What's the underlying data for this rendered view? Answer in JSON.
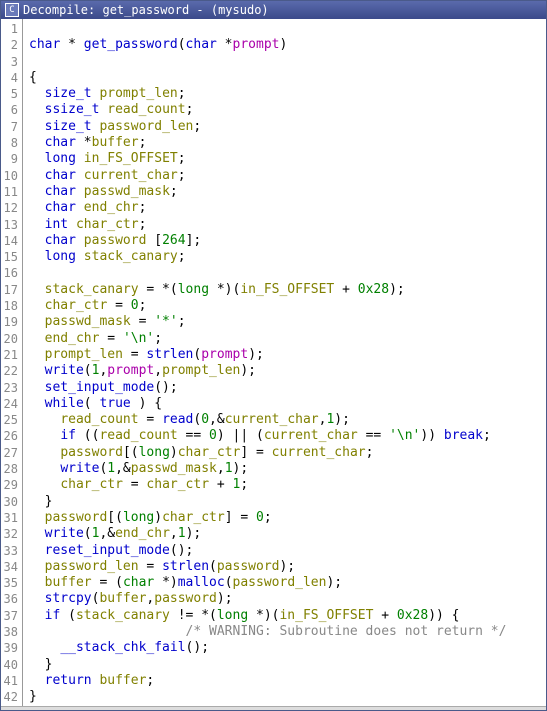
{
  "title": {
    "icon_label": "C",
    "text": "Decompile: get_password -  (mysudo)"
  },
  "lines": [
    {
      "n": 1,
      "html": ""
    },
    {
      "n": 2,
      "html": "<span class='type'>char</span> * <span class='fn'>get_password</span>(<span class='type'>char</span> *<span class='param'>prompt</span>)"
    },
    {
      "n": 3,
      "html": ""
    },
    {
      "n": 4,
      "html": "{"
    },
    {
      "n": 5,
      "html": "  <span class='type'>size_t</span> <span class='var'>prompt_len</span>;"
    },
    {
      "n": 6,
      "html": "  <span class='type'>ssize_t</span> <span class='var'>read_count</span>;"
    },
    {
      "n": 7,
      "html": "  <span class='type'>size_t</span> <span class='var'>password_len</span>;"
    },
    {
      "n": 8,
      "html": "  <span class='type'>char</span> *<span class='var'>buffer</span>;"
    },
    {
      "n": 9,
      "html": "  <span class='type'>long</span> <span class='var'>in_FS_OFFSET</span>;"
    },
    {
      "n": 10,
      "html": "  <span class='type'>char</span> <span class='var'>current_char</span>;"
    },
    {
      "n": 11,
      "html": "  <span class='type'>char</span> <span class='var'>passwd_mask</span>;"
    },
    {
      "n": 12,
      "html": "  <span class='type'>char</span> <span class='var'>end_chr</span>;"
    },
    {
      "n": 13,
      "html": "  <span class='type'>int</span> <span class='var'>char_ctr</span>;"
    },
    {
      "n": 14,
      "html": "  <span class='type'>char</span> <span class='var'>password</span> [<span class='num'>264</span>];"
    },
    {
      "n": 15,
      "html": "  <span class='type'>long</span> <span class='var'>stack_canary</span>;"
    },
    {
      "n": 16,
      "html": ""
    },
    {
      "n": 17,
      "html": "  <span class='var'>stack_canary</span> = *(<span class='cast'>long</span> *)(<span class='var'>in_FS_OFFSET</span> + <span class='num'>0x28</span>);"
    },
    {
      "n": 18,
      "html": "  <span class='var'>char_ctr</span> = <span class='num'>0</span>;"
    },
    {
      "n": 19,
      "html": "  <span class='var'>passwd_mask</span> = <span class='str'>'*'</span>;"
    },
    {
      "n": 20,
      "html": "  <span class='var'>end_chr</span> = <span class='str'>'\\n'</span>;"
    },
    {
      "n": 21,
      "html": "  <span class='var'>prompt_len</span> = <span class='fn'>strlen</span>(<span class='param'>prompt</span>);"
    },
    {
      "n": 22,
      "html": "  <span class='fn'>write</span>(<span class='num'>1</span>,<span class='param'>prompt</span>,<span class='var'>prompt_len</span>);"
    },
    {
      "n": 23,
      "html": "  <span class='fn'>set_input_mode</span>();"
    },
    {
      "n": 24,
      "html": "  <span class='kw'>while</span>( <span class='kw'>true</span> ) {"
    },
    {
      "n": 25,
      "html": "    <span class='var'>read_count</span> = <span class='fn'>read</span>(<span class='num'>0</span>,&amp;<span class='var'>current_char</span>,<span class='num'>1</span>);"
    },
    {
      "n": 26,
      "html": "    <span class='kw'>if</span> ((<span class='var'>read_count</span> == <span class='num'>0</span>) || (<span class='var'>current_char</span> == <span class='str'>'\\n'</span>)) <span class='kw'>break</span>;"
    },
    {
      "n": 27,
      "html": "    <span class='var'>password</span>[(<span class='cast'>long</span>)<span class='var'>char_ctr</span>] = <span class='var'>current_char</span>;"
    },
    {
      "n": 28,
      "html": "    <span class='fn'>write</span>(<span class='num'>1</span>,&amp;<span class='var'>passwd_mask</span>,<span class='num'>1</span>);"
    },
    {
      "n": 29,
      "html": "    <span class='var'>char_ctr</span> = <span class='var'>char_ctr</span> + <span class='num'>1</span>;"
    },
    {
      "n": 30,
      "html": "  }"
    },
    {
      "n": 31,
      "html": "  <span class='var'>password</span>[(<span class='cast'>long</span>)<span class='var'>char_ctr</span>] = <span class='num'>0</span>;"
    },
    {
      "n": 32,
      "html": "  <span class='fn'>write</span>(<span class='num'>1</span>,&amp;<span class='var'>end_chr</span>,<span class='num'>1</span>);"
    },
    {
      "n": 33,
      "html": "  <span class='fn'>reset_input_mode</span>();"
    },
    {
      "n": 34,
      "html": "  <span class='var'>password_len</span> = <span class='fn'>strlen</span>(<span class='var'>password</span>);"
    },
    {
      "n": 35,
      "html": "  <span class='var'>buffer</span> = (<span class='cast'>char</span> *)<span class='fn'>malloc</span>(<span class='var'>password_len</span>);"
    },
    {
      "n": 36,
      "html": "  <span class='fn'>strcpy</span>(<span class='var'>buffer</span>,<span class='var'>password</span>);"
    },
    {
      "n": 37,
      "html": "  <span class='kw'>if</span> (<span class='var'>stack_canary</span> != *(<span class='cast'>long</span> *)(<span class='var'>in_FS_OFFSET</span> + <span class='num'>0x28</span>)) {"
    },
    {
      "n": 38,
      "html": "                    <span class='comment'>/* WARNING: Subroutine does not return */</span>"
    },
    {
      "n": 39,
      "html": "    <span class='fn'>__stack_chk_fail</span>();"
    },
    {
      "n": 40,
      "html": "  }"
    },
    {
      "n": 41,
      "html": "  <span class='kw'>return</span> <span class='var'>buffer</span>;"
    },
    {
      "n": 42,
      "html": "}"
    }
  ]
}
